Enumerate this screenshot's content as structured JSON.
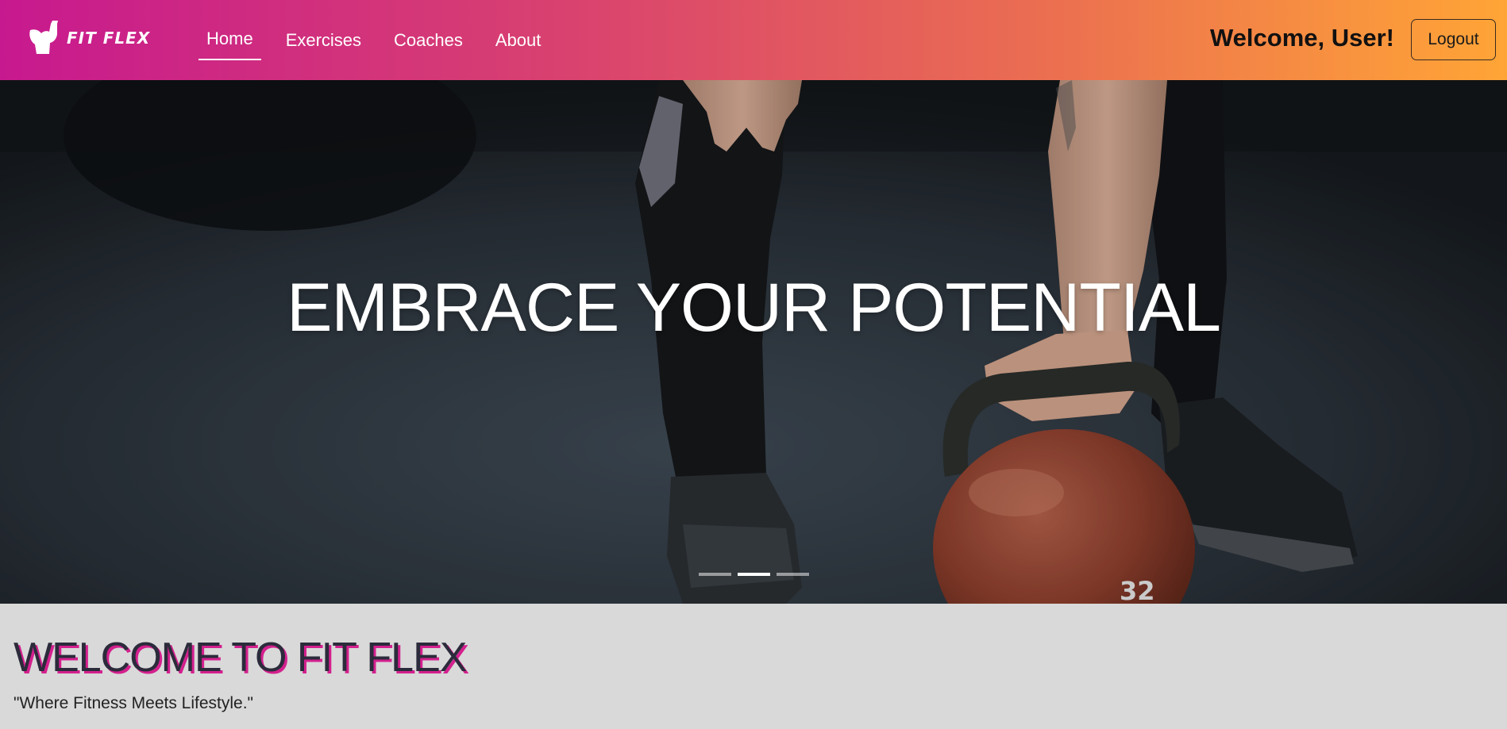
{
  "brand": {
    "logo_text": "FIT FLEX"
  },
  "nav": {
    "items": [
      {
        "label": "Home",
        "active": true
      },
      {
        "label": "Exercises",
        "active": false
      },
      {
        "label": "Coaches",
        "active": false
      },
      {
        "label": "About",
        "active": false
      }
    ]
  },
  "user": {
    "welcome": "Welcome, User!",
    "logout_label": "Logout"
  },
  "hero": {
    "title": "EMBRACE YOUR POTENTIAL",
    "kettlebell_number": "32",
    "slides_count": 3,
    "active_slide_index": 1
  },
  "welcome_section": {
    "heading": "WELCOME TO FIT FLEX",
    "tagline": "\"Where Fitness Meets Lifestyle.\""
  },
  "colors": {
    "nav_gradient_start": "#c7198f",
    "nav_gradient_end": "#ffa536",
    "heading_shadow": "#d4208e",
    "section_bg": "#d9d9d9"
  }
}
